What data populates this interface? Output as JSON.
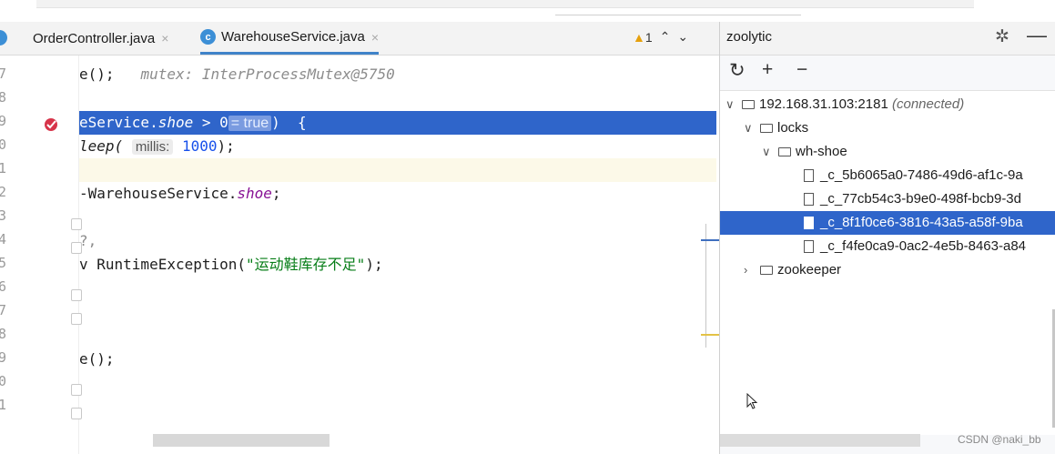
{
  "tabs": [
    {
      "label": "OrderController.java"
    },
    {
      "label": "WarehouseService.java"
    }
  ],
  "tab_icon_letter": "c",
  "close_glyph": "×",
  "warning": {
    "glyph": "▲",
    "count": "1",
    "up": "⌃",
    "down": "⌄"
  },
  "line_numbers": [
    "7",
    "8",
    "9",
    "0",
    "1",
    "2",
    "3",
    "4",
    "5",
    "6",
    "7",
    "8",
    "9",
    "0",
    "1"
  ],
  "code": {
    "l7_a": "e();",
    "l7_b": "mutex: InterProcessMutex@5750",
    "l9_a": "eService.",
    "l9_b": "shoe",
    "l9_c": " > 0",
    "l9_true": "= true",
    "l9_d": ")  {",
    "l10_a": "leep(",
    "l10_hint": "millis:",
    "l10_num": "1000",
    "l10_b": ");",
    "l12_a": "-WarehouseService.",
    "l12_b": "shoe",
    "l12_c": ";",
    "l14": "?,",
    "l15_a": "v RuntimeException(",
    "l15_str": "\"运动鞋库存不足\"",
    "l15_b": ");",
    "l19": "e();"
  },
  "panel": {
    "title": "zoolytic",
    "gear_glyph": "✲",
    "minus_glyph": "—",
    "refresh_glyph": "↻",
    "add_glyph": "+",
    "remove_glyph": "−"
  },
  "tree": {
    "root": "192.168.31.103:2181",
    "root_status": "(connected)",
    "locks": "locks",
    "whshoe": "wh-shoe",
    "children": [
      "_c_5b6065a0-7486-49d6-af1c-9a",
      "_c_77cb54c3-b9e0-498f-bcb9-3d",
      "_c_8f1f0ce6-3816-43a5-a58f-9ba",
      "_c_f4fe0ca9-0ac2-4e5b-8463-a84"
    ],
    "zookeeper": "zookeeper",
    "expanded_glyph": "∨",
    "collapsed_glyph": "›"
  },
  "watermark": "CSDN @naki_bb"
}
